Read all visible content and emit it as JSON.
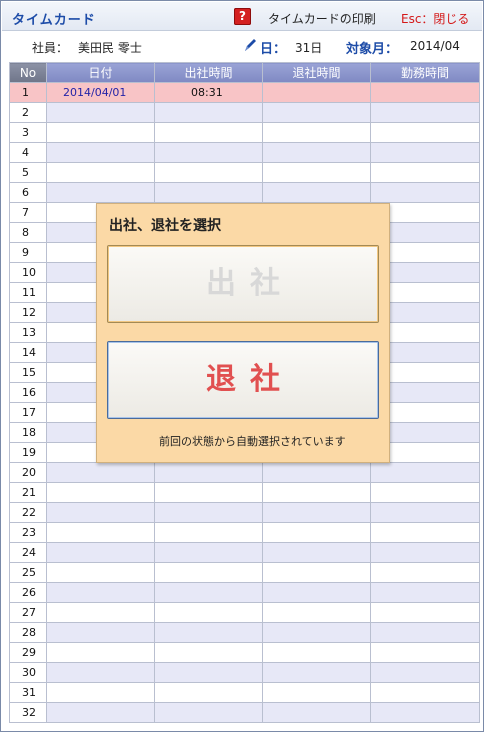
{
  "window": {
    "title": "タイムカード",
    "help_icon": "?",
    "print_label": "タイムカードの印刷",
    "close_label": "Esc：閉じる"
  },
  "info": {
    "employee_label": "社員：",
    "employee_name": "美田民 零士",
    "day_label": "日：",
    "day_value": "31日",
    "month_label": "対象月：",
    "month_value": "2014/04"
  },
  "table": {
    "headers": [
      "No",
      "日付",
      "出社時間",
      "退社時間",
      "勤務時間"
    ],
    "selected_row": 1,
    "rows": [
      {
        "no": "1",
        "date": "2014/04/01",
        "in": "08:31",
        "out": "",
        "work": ""
      },
      {
        "no": "2",
        "date": "",
        "in": "",
        "out": "",
        "work": ""
      },
      {
        "no": "3",
        "date": "",
        "in": "",
        "out": "",
        "work": ""
      },
      {
        "no": "4",
        "date": "",
        "in": "",
        "out": "",
        "work": ""
      },
      {
        "no": "5",
        "date": "",
        "in": "",
        "out": "",
        "work": ""
      },
      {
        "no": "6",
        "date": "",
        "in": "",
        "out": "",
        "work": ""
      },
      {
        "no": "7",
        "date": "",
        "in": "",
        "out": "",
        "work": ""
      },
      {
        "no": "8",
        "date": "",
        "in": "",
        "out": "",
        "work": ""
      },
      {
        "no": "9",
        "date": "",
        "in": "",
        "out": "",
        "work": ""
      },
      {
        "no": "10",
        "date": "",
        "in": "",
        "out": "",
        "work": ""
      },
      {
        "no": "11",
        "date": "",
        "in": "",
        "out": "",
        "work": ""
      },
      {
        "no": "12",
        "date": "",
        "in": "",
        "out": "",
        "work": ""
      },
      {
        "no": "13",
        "date": "",
        "in": "",
        "out": "",
        "work": ""
      },
      {
        "no": "14",
        "date": "",
        "in": "",
        "out": "",
        "work": ""
      },
      {
        "no": "15",
        "date": "",
        "in": "",
        "out": "",
        "work": ""
      },
      {
        "no": "16",
        "date": "",
        "in": "",
        "out": "",
        "work": ""
      },
      {
        "no": "17",
        "date": "",
        "in": "",
        "out": "",
        "work": ""
      },
      {
        "no": "18",
        "date": "",
        "in": "",
        "out": "",
        "work": ""
      },
      {
        "no": "19",
        "date": "",
        "in": "",
        "out": "",
        "work": ""
      },
      {
        "no": "20",
        "date": "",
        "in": "",
        "out": "",
        "work": ""
      },
      {
        "no": "21",
        "date": "",
        "in": "",
        "out": "",
        "work": ""
      },
      {
        "no": "22",
        "date": "",
        "in": "",
        "out": "",
        "work": ""
      },
      {
        "no": "23",
        "date": "",
        "in": "",
        "out": "",
        "work": ""
      },
      {
        "no": "24",
        "date": "",
        "in": "",
        "out": "",
        "work": ""
      },
      {
        "no": "25",
        "date": "",
        "in": "",
        "out": "",
        "work": ""
      },
      {
        "no": "26",
        "date": "",
        "in": "",
        "out": "",
        "work": ""
      },
      {
        "no": "27",
        "date": "",
        "in": "",
        "out": "",
        "work": ""
      },
      {
        "no": "28",
        "date": "",
        "in": "",
        "out": "",
        "work": ""
      },
      {
        "no": "29",
        "date": "",
        "in": "",
        "out": "",
        "work": ""
      },
      {
        "no": "30",
        "date": "",
        "in": "",
        "out": "",
        "work": ""
      },
      {
        "no": "31",
        "date": "",
        "in": "",
        "out": "",
        "work": ""
      },
      {
        "no": "32",
        "date": "",
        "in": "",
        "out": "",
        "work": ""
      }
    ]
  },
  "dialog": {
    "title": "出社、退社を選択",
    "clock_in_label": "出社",
    "clock_out_label": "退社",
    "note": "前回の状態から自動選択されています"
  },
  "colors": {
    "accent": "#1d4ca8",
    "close": "#d41818",
    "selected_row": "#f8c4c6",
    "dialog_bg": "#fbd9a6",
    "clock_out_text": "#e15050"
  },
  "icons": {
    "help": "help-icon",
    "pen": "pen-icon"
  }
}
